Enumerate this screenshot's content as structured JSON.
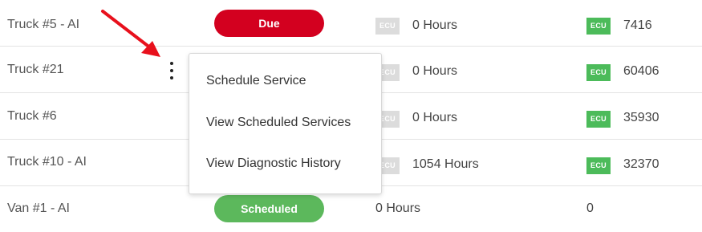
{
  "ecu_label": "ECU",
  "rows": [
    {
      "name": "Truck #5 - AI",
      "status": "Due",
      "hours": "0 Hours",
      "mileage": "7416"
    },
    {
      "name": "Truck #21",
      "hours": "0 Hours",
      "mileage": "60406"
    },
    {
      "name": "Truck #6",
      "hours": "0 Hours",
      "mileage": "35930"
    },
    {
      "name": "Truck #10 - AI",
      "hours": "1054 Hours",
      "mileage": "32370"
    },
    {
      "name": "Van #1 - AI",
      "status": "Scheduled",
      "hours": "0 Hours",
      "mileage": "0"
    }
  ],
  "menu": {
    "items": [
      "Schedule Service",
      "View Scheduled Services",
      "View Diagnostic History"
    ]
  },
  "colors": {
    "due": "#d3001f",
    "scheduled": "#5cb85c",
    "ecu_active": "#4cbb5a",
    "ecu_inactive": "#dcdcdc",
    "annotation_arrow": "#e8101c"
  },
  "icons": [
    "kebab-menu-icon",
    "annotation-arrow"
  ]
}
